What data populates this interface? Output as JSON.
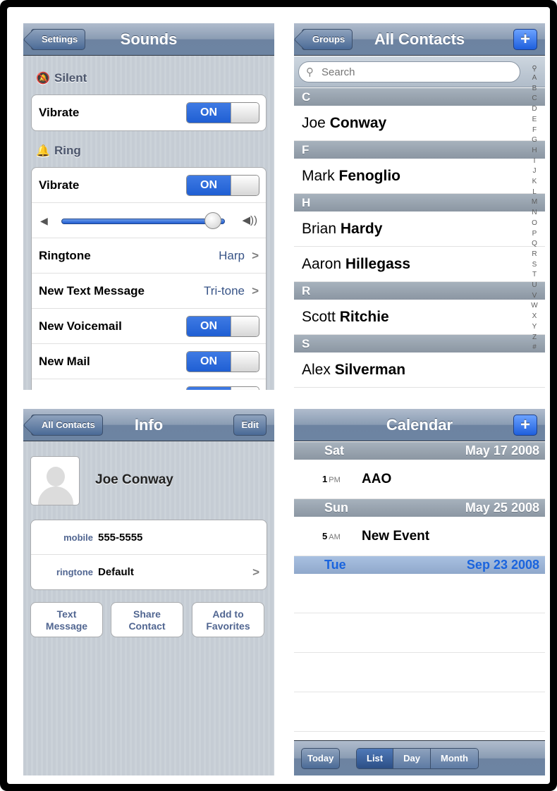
{
  "sounds": {
    "back_label": "Settings",
    "title": "Sounds",
    "silent_header": "Silent",
    "silent_vibrate_label": "Vibrate",
    "silent_vibrate_state": "ON",
    "ring_header": "Ring",
    "ring_vibrate_label": "Vibrate",
    "ring_vibrate_state": "ON",
    "volume_level": 0.92,
    "rows": [
      {
        "label": "Ringtone",
        "value": "Harp"
      },
      {
        "label": "New Text Message",
        "value": "Tri-tone"
      }
    ],
    "toggle_rows": [
      {
        "label": "New Voicemail",
        "state": "ON"
      },
      {
        "label": "New Mail",
        "state": "ON"
      }
    ]
  },
  "contacts": {
    "back_label": "Groups",
    "title": "All Contacts",
    "add_label": "+",
    "search_placeholder": "Search",
    "sections": [
      {
        "letter": "C",
        "people": [
          {
            "first": "Joe",
            "last": "Conway"
          }
        ]
      },
      {
        "letter": "F",
        "people": [
          {
            "first": "Mark",
            "last": "Fenoglio"
          }
        ]
      },
      {
        "letter": "H",
        "people": [
          {
            "first": "Brian",
            "last": "Hardy"
          },
          {
            "first": "Aaron",
            "last": "Hillegass"
          }
        ]
      },
      {
        "letter": "R",
        "people": [
          {
            "first": "Scott",
            "last": "Ritchie"
          }
        ]
      },
      {
        "letter": "S",
        "people": [
          {
            "first": "Alex",
            "last": "Silverman"
          }
        ]
      }
    ],
    "index": [
      "A",
      "B",
      "C",
      "D",
      "E",
      "F",
      "G",
      "H",
      "I",
      "J",
      "K",
      "L",
      "M",
      "N",
      "O",
      "P",
      "Q",
      "R",
      "S",
      "T",
      "U",
      "V",
      "W",
      "X",
      "Y",
      "Z",
      "#"
    ]
  },
  "info": {
    "back_label": "All Contacts",
    "title": "Info",
    "edit_label": "Edit",
    "name": "Joe Conway",
    "mobile_key": "mobile",
    "mobile_val": "555-5555",
    "ringtone_key": "ringtone",
    "ringtone_val": "Default",
    "btn_text_line1": "Text",
    "btn_text_line2": "Message",
    "btn_share_line1": "Share",
    "btn_share_line2": "Contact",
    "btn_fav_line1": "Add to",
    "btn_fav_line2": "Favorites"
  },
  "calendar": {
    "title": "Calendar",
    "add_label": "+",
    "days": [
      {
        "day": "Sat",
        "date": "May 17 2008",
        "events": [
          {
            "hour": "1",
            "ampm": "PM",
            "title": "AAO"
          }
        ]
      },
      {
        "day": "Sun",
        "date": "May 25 2008",
        "events": [
          {
            "hour": "5",
            "ampm": "AM",
            "title": "New Event"
          }
        ]
      }
    ],
    "today_day": "Tue",
    "today_date": "Sep 23 2008",
    "today_label": "Today",
    "seg_list": "List",
    "seg_day": "Day",
    "seg_month": "Month"
  }
}
